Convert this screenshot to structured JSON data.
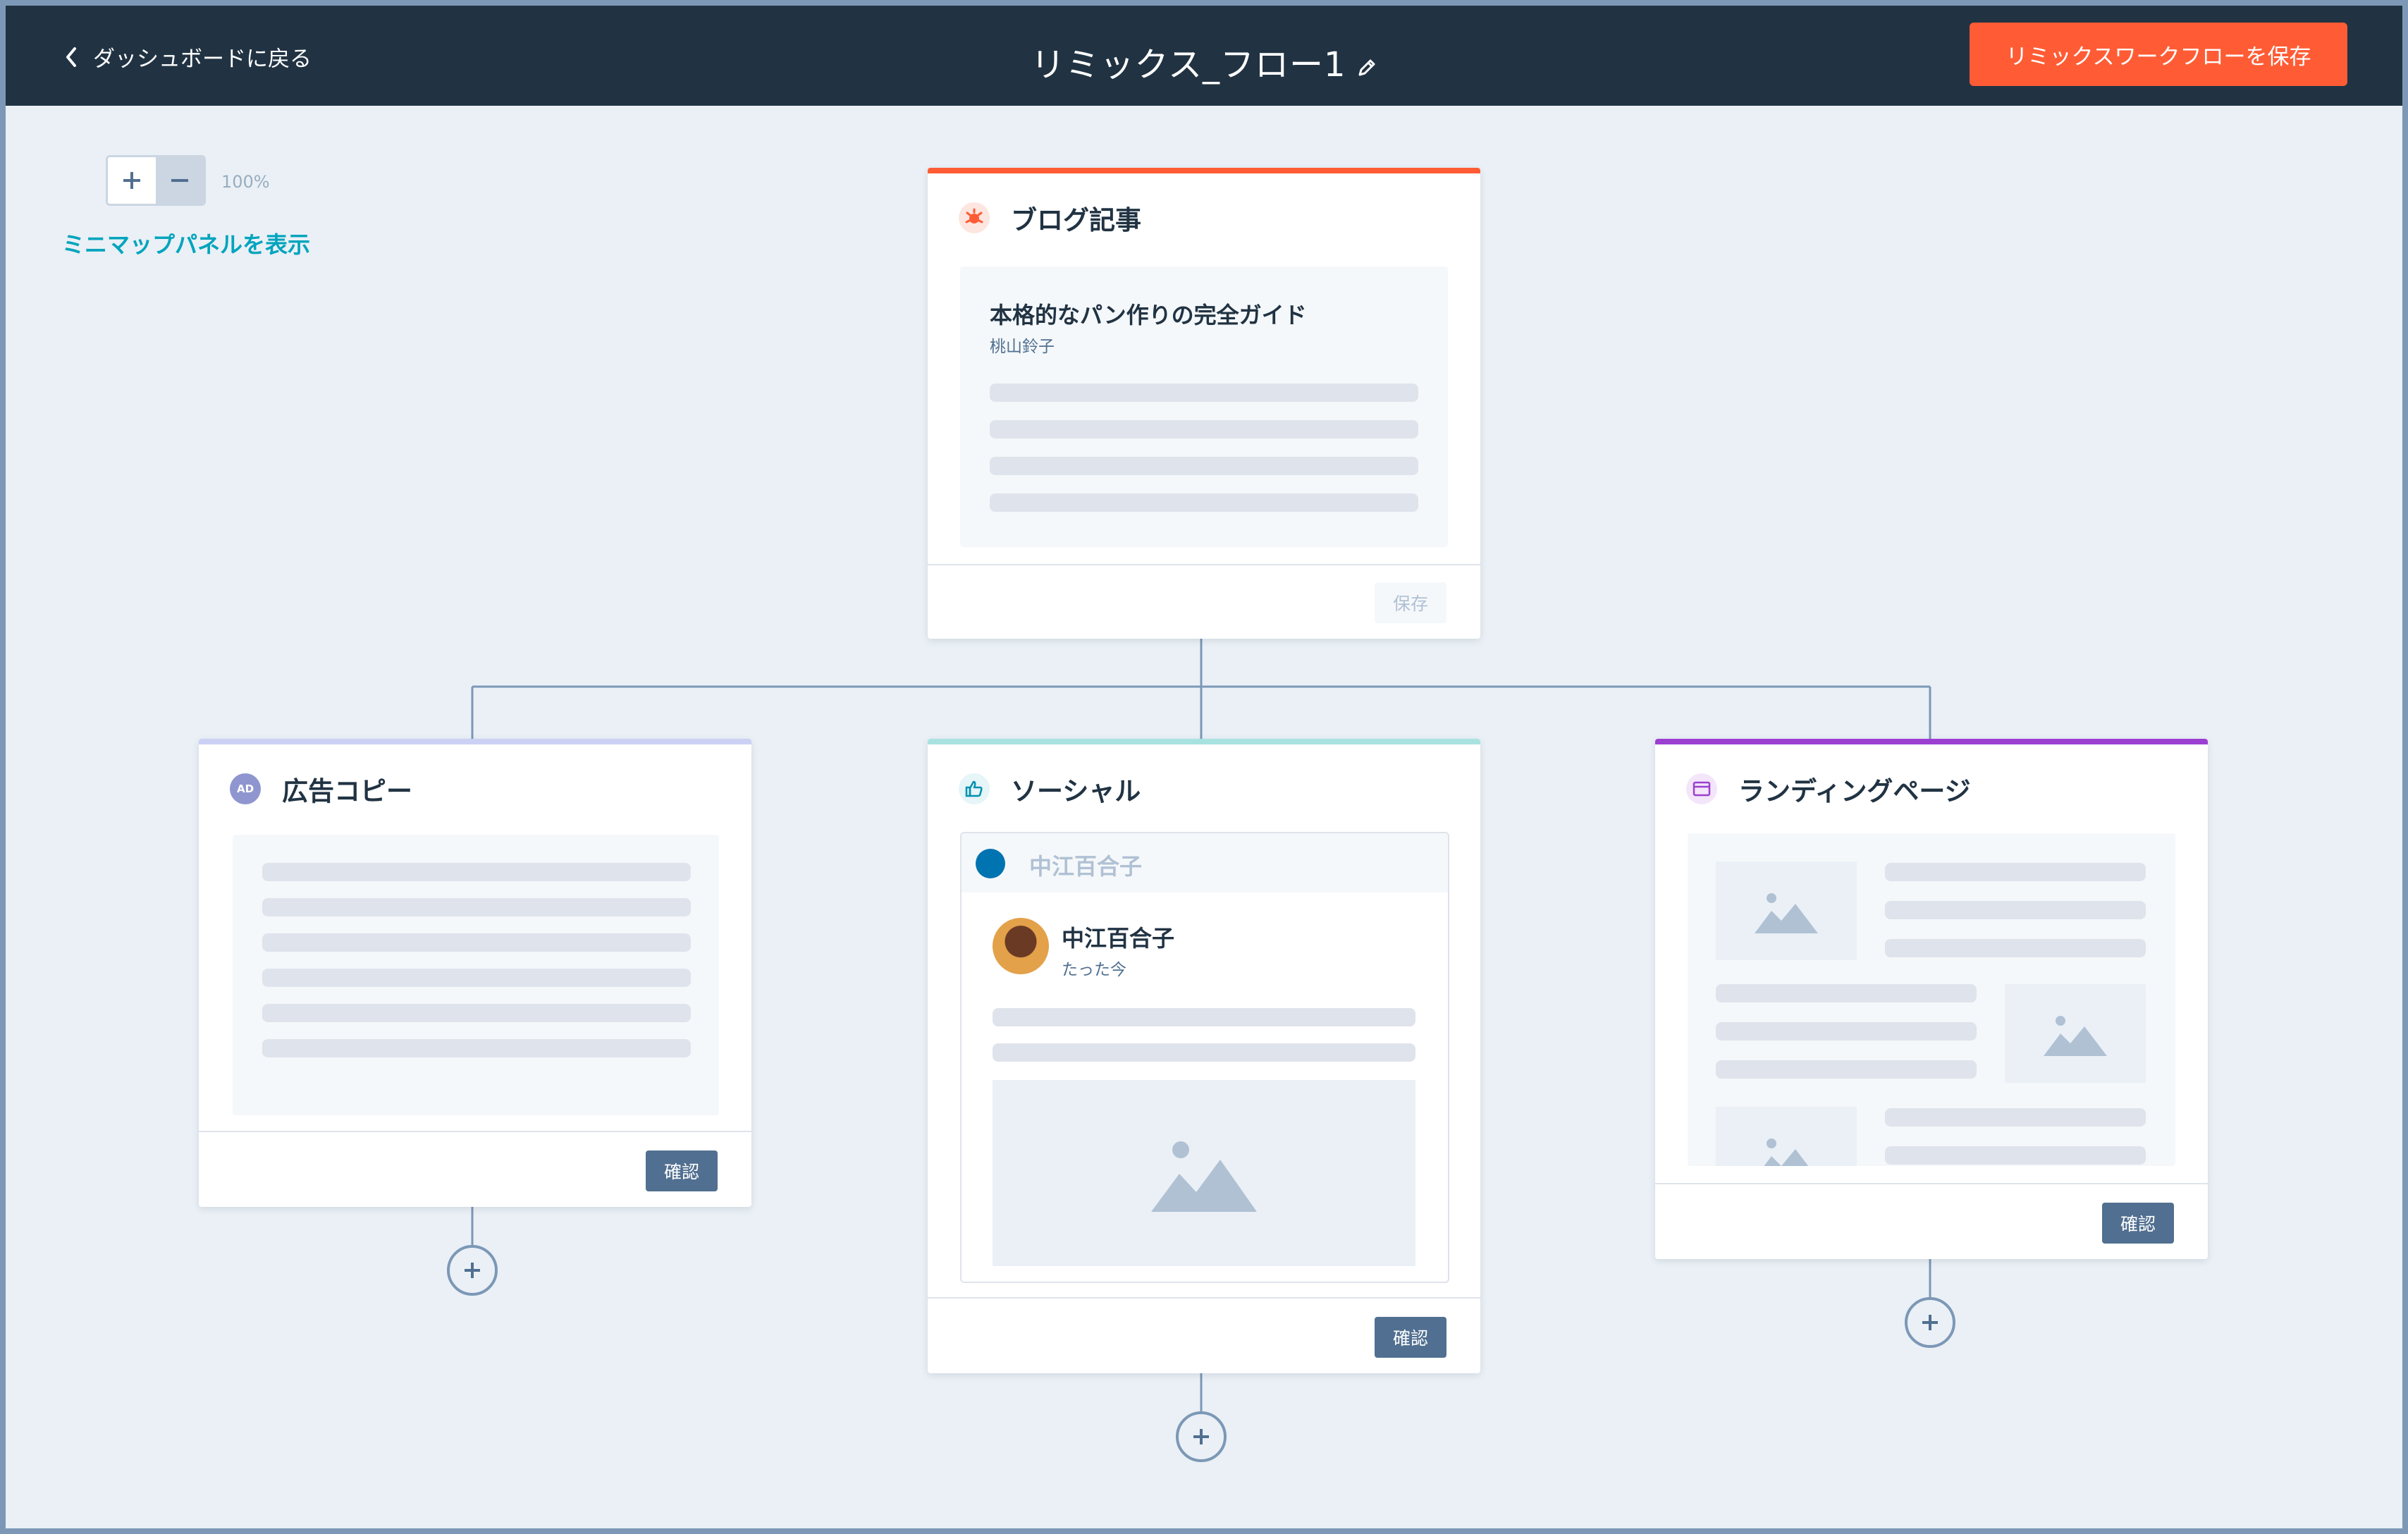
{
  "header": {
    "back_label": "ダッシュボードに戻る",
    "title": "リミックス_フロー1",
    "save_label": "リミックスワークフローを保存"
  },
  "canvas": {
    "zoom_level": "100%",
    "zoom_in_label": "+",
    "zoom_out_label": "−",
    "minimap_label": "ミニマップパネルを表示"
  },
  "cards": {
    "blog": {
      "title": "ブログ記事",
      "article_title": "本格的なパン作りの完全ガイド",
      "author": "桃山鈴子",
      "action_label": "保存",
      "accent": "#ff5c35"
    },
    "ad": {
      "title": "広告コピー",
      "icon_text": "AD",
      "action_label": "確認",
      "accent": "#cbd1f4"
    },
    "social": {
      "title": "ソーシャル",
      "account_name": "中江百合子",
      "poster_name": "中江百合子",
      "post_time": "たった今",
      "action_label": "確認",
      "accent": "#a8e2e0"
    },
    "landing": {
      "title": "ランディングページ",
      "action_label": "確認",
      "accent": "#9b3fd1"
    }
  },
  "colors": {
    "header_bg": "#213343",
    "primary": "#ff5c35",
    "link": "#00a4bd",
    "confirm_button": "#516f90"
  }
}
